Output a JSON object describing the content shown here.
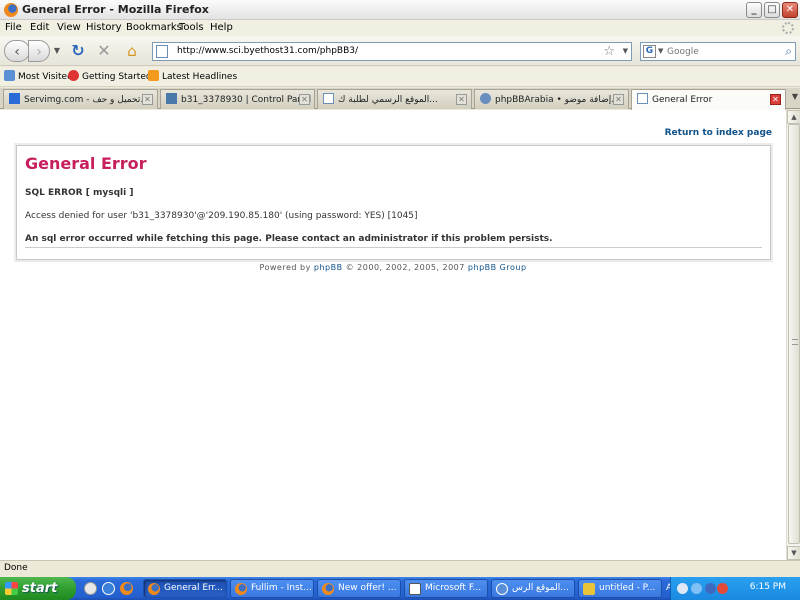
{
  "window": {
    "title": "General Error - Mozilla Firefox"
  },
  "menu": {
    "items": [
      "File",
      "Edit",
      "View",
      "History",
      "Bookmarks",
      "Tools",
      "Help"
    ]
  },
  "navigation": {
    "url": "http://www.sci.byethost31.com/phpBB3/",
    "search_placeholder": "Google",
    "search_engine_icon": "google-icon"
  },
  "bookmarks": [
    {
      "label": "Most Visited",
      "icon": "most-visited-icon"
    },
    {
      "label": "Getting Started",
      "icon": "getting-started-icon"
    },
    {
      "label": "Latest Headlines",
      "icon": "rss-icon"
    }
  ],
  "tabs": [
    {
      "label": "Servimg.com - تحميل و حف...",
      "active": false
    },
    {
      "label": "b31_3378930 | Control Panel",
      "active": false
    },
    {
      "label": "الموقع الرسمي لطلبة ك...",
      "active": false
    },
    {
      "label": "phpBBArabia • إضافة موضو...",
      "active": false
    },
    {
      "label": "General Error",
      "active": true
    }
  ],
  "page": {
    "return_link": "Return to index page",
    "heading": "General Error",
    "sql_error": "SQL ERROR [ mysqli ]",
    "access_denied": "Access denied for user 'b31_3378930'@'209.190.85.180' (using password: YES) [1045]",
    "message": "An sql error occurred while fetching this page. Please contact an administrator if this problem persists.",
    "powered_prefix": "Powered by",
    "powered_link1": "phpBB",
    "powered_middle": "© 2000, 2002, 2005, 2007",
    "powered_link2": "phpBB Group"
  },
  "status": {
    "text": "Done"
  },
  "taskbar": {
    "start_label": "start",
    "tasks": [
      {
        "label": "General Err...",
        "active": true
      },
      {
        "label": "Fullim - Inst...",
        "active": false
      },
      {
        "label": "New offer! ...",
        "active": false
      },
      {
        "label": "Microsoft F...",
        "active": false
      },
      {
        "label": "الموقع الرس...",
        "active": false
      },
      {
        "label": "untitled - P...",
        "active": false
      }
    ],
    "language": "AR",
    "clock": "6:15 PM"
  },
  "colors": {
    "heading": "#c71f5e",
    "link": "#105289",
    "taskbar": "#2460cf",
    "start_button": "#2f9e2f"
  }
}
